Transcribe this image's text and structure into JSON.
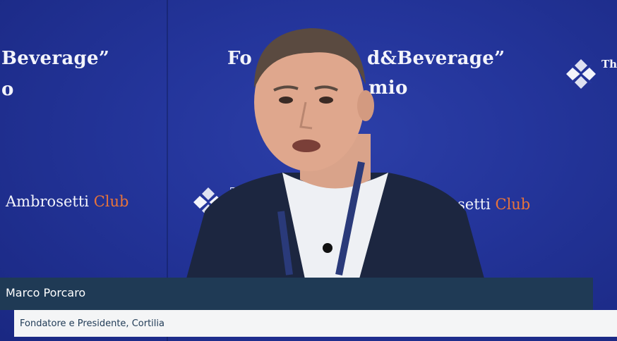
{
  "backdrop": {
    "left_banner_line1": "Beverage”",
    "left_banner_line2": "o",
    "center_banner_line1_left": "Fo",
    "center_banner_line1_right": "d&Beverage”",
    "center_banner_line2": "mio",
    "club_brand": "Ambrosetti",
    "club_word": "Club",
    "club_brand_partial": "setti",
    "the_label": "The",
    "the_label_partial": "The F",
    "accent_color": "#e8743a",
    "background_color": "#24359b"
  },
  "lower_third": {
    "name": "Marco Porcaro",
    "role": "Fondatore e Presidente, Cortilia",
    "bar_color": "#1f3a55"
  }
}
